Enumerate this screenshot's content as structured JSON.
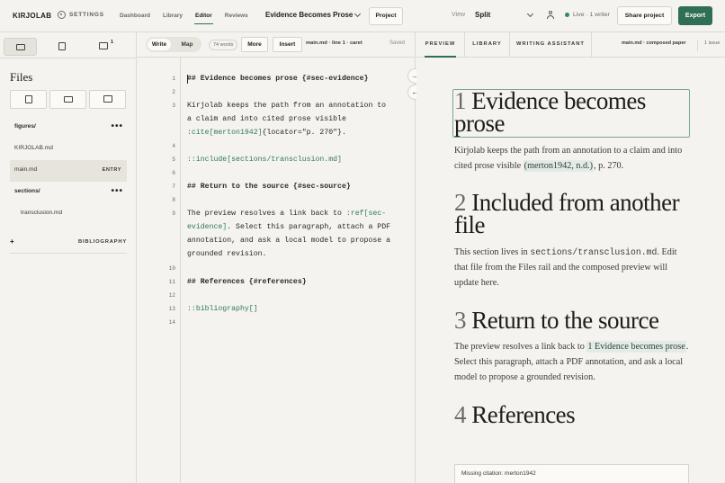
{
  "app": {
    "brand": "KIRJOLAB",
    "settings_label": "SETTINGS"
  },
  "nav": {
    "tabs": [
      "Dashboard",
      "Library",
      "Editor",
      "Reviews"
    ],
    "active": "Editor"
  },
  "document": {
    "title": "Evidence Becomes Prose"
  },
  "header": {
    "project_label": "Project",
    "view_label": "View",
    "view_value": "Split",
    "live_status": "Live · 1 writer",
    "share_label": "Share project",
    "export_label": "Export"
  },
  "sidebar": {
    "comment_count": "1",
    "files_title": "Files",
    "tree": [
      {
        "label": "figures/",
        "type": "folder"
      },
      {
        "label": "KIRJOLAB.md",
        "type": "file"
      },
      {
        "label": "main.md",
        "type": "file",
        "tag": "ENTRY"
      },
      {
        "label": "sections/",
        "type": "folder"
      },
      {
        "label": "transclusion.md",
        "type": "file"
      }
    ],
    "more_glyph": "•••",
    "plus_glyph": "+",
    "bibliography_label": "BIBLIOGRAPHY"
  },
  "editor": {
    "mode_write": "Write",
    "mode_map": "Map",
    "word_count": "74 words",
    "more_label": "More",
    "insert_label": "Insert",
    "caret_info": "main.md · line 1 · caret",
    "saved_label": "Saved",
    "line_numbers": [
      "1",
      "2",
      "3",
      "4",
      "5",
      "6",
      "7",
      "8",
      "9",
      "10",
      "11",
      "12",
      "13",
      "14"
    ],
    "line1": "## Evidence becomes prose {#sec-evidence}",
    "line3a": "Kirjolab keeps the path from an annotation to",
    "line3b": "a claim and into cited prose visible",
    "line3c_cite": ":cite[merton1942]",
    "line3c_rest": "{locator=\"p. 270\"}.",
    "line5": "::include[sections/transclusion.md]",
    "line7": "## Return to the source {#sec-source}",
    "line9a_pre": "The preview resolves a link back to ",
    "line9a_ref": ":ref[sec-",
    "line9b_ref": "evidence]",
    "line9b_rest": ". Select this paragraph, attach a PDF",
    "line9c": "annotation, and ask a local model to propose a",
    "line9d": "grounded revision.",
    "line11": "## References {#references}",
    "line13": "::bibliography[]",
    "arrow_right": "→",
    "arrow_left": "←"
  },
  "preview": {
    "tabs": [
      "PREVIEW",
      "LIBRARY",
      "WRITING ASSISTANT"
    ],
    "active_tab": "PREVIEW",
    "file_label": "main.md · composed paper",
    "issue_label": "1 issue",
    "sections": {
      "s1_num": "1",
      "s1_title": "Evidence becomes prose",
      "s1_text_pre": "Kirjolab keeps the path from an annotation to a claim and into cited prose visible ",
      "s1_cite": "(merton1942, n.d.)",
      "s1_text_post": ", p. 270.",
      "s2_num": "2",
      "s2_title": "Included from another file",
      "s2_text_pre": "This section lives in ",
      "s2_code": "sections/transclusion.md",
      "s2_text_post": ". Edit that file from the Files rail and the composed preview will update here.",
      "s3_num": "3",
      "s3_title": "Return to the source",
      "s3_text_pre": "The preview resolves a link back to ",
      "s3_ref": "1 Evidence becomes prose",
      "s3_text_post": ". Select this paragraph, attach a PDF annotation, and ask a local model to propose a grounded revision.",
      "s4_num": "4",
      "s4_title": "References"
    },
    "missing_citation": "Missing citation: merton1942"
  },
  "colors": {
    "accent": "#2f6f55",
    "background": "#f4f3ef",
    "link_highlight": "#e2ece6"
  }
}
